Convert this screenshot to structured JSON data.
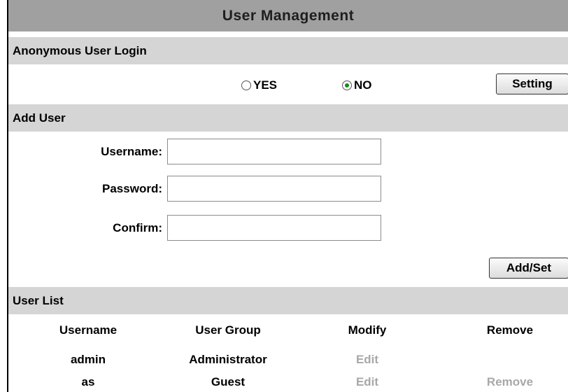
{
  "title": "User Management",
  "anonymous": {
    "header": "Anonymous User Login",
    "options": [
      {
        "label": "YES",
        "checked": false
      },
      {
        "label": "NO",
        "checked": true
      }
    ],
    "setting_label": "Setting"
  },
  "add_user": {
    "header": "Add User",
    "fields": [
      {
        "label": "Username:",
        "value": ""
      },
      {
        "label": "Password:",
        "value": ""
      },
      {
        "label": "Confirm:",
        "value": ""
      }
    ],
    "submit_label": "Add/Set"
  },
  "user_list": {
    "header": "User List",
    "columns": [
      "Username",
      "User Group",
      "Modify",
      "Remove"
    ],
    "rows": [
      {
        "username": "admin",
        "group": "Administrator",
        "modify": "Edit",
        "remove": ""
      },
      {
        "username": "as",
        "group": "Guest",
        "modify": "Edit",
        "remove": "Remove"
      }
    ]
  },
  "colors": {
    "title_bg": "#a0a0a0",
    "section_bg": "#d5d5d5",
    "radio_checked": "#1a8a1a",
    "disabled_link": "#a8a8a8"
  }
}
